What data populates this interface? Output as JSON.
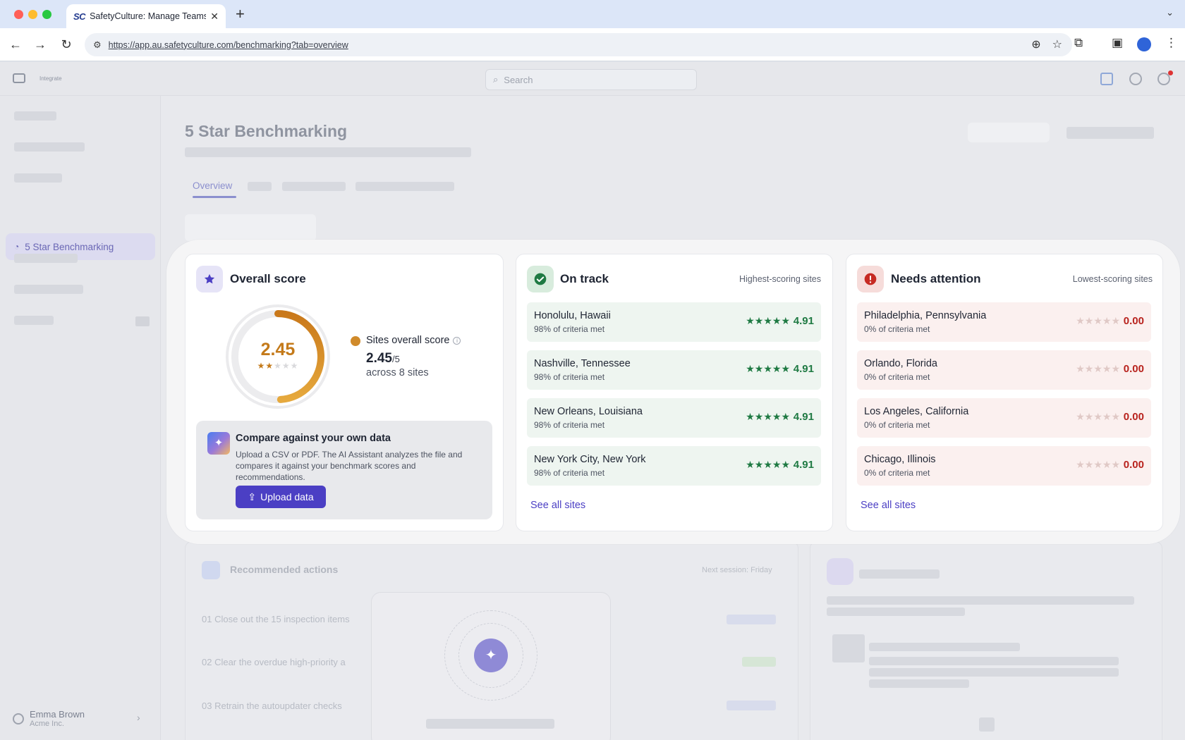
{
  "browser": {
    "tab_icon": "SC",
    "tab_title": "SafetyCulture: Manage Teams and...",
    "new_tab": "+",
    "url": "https://app.au.safetyculture.com/benchmarking?tab=overview"
  },
  "app": {
    "brand": "Integrate",
    "search_placeholder": "Search",
    "page_title": "5 Star Benchmarking",
    "active_tab": "Overview",
    "sidebar": {
      "active_item": "5 Star Benchmarking",
      "user_name": "Emma Brown",
      "user_org": "Acme Inc."
    },
    "recommended": {
      "title": "Recommended actions",
      "meta": "Next session: Friday",
      "items": [
        "01 Close out the 15 inspection items",
        "02 Clear the overdue high-priority a",
        "03 Retrain the autoupdater checks"
      ]
    }
  },
  "overall": {
    "title": "Overall score",
    "score": "2.45",
    "score_value": 2.45,
    "max_score": 5,
    "stars": "★★★★★",
    "legend_label": "Sites overall score",
    "big_score": "2.45",
    "big_score_max": "/5",
    "across": "across 8 sites",
    "compare_title": "Compare against your own data",
    "compare_desc": "Upload a CSV or PDF. The AI Assistant analyzes the file and compares it against your benchmark scores and recommendations.",
    "upload_label": "Upload data",
    "accent": "#d08a2a"
  },
  "on_track": {
    "title": "On track",
    "subtitle": "Highest-scoring sites",
    "accent": "#1f7a43",
    "sites": [
      {
        "name": "Honolulu, Hawaii",
        "meta": "98% of criteria met",
        "stars": "★★★★★",
        "score": "4.91"
      },
      {
        "name": "Nashville, Tennessee",
        "meta": "98% of criteria met",
        "stars": "★★★★★",
        "score": "4.91"
      },
      {
        "name": "New Orleans, Louisiana",
        "meta": "98% of criteria met",
        "stars": "★★★★★",
        "score": "4.91"
      },
      {
        "name": "New York City, New York",
        "meta": "98% of criteria met",
        "stars": "★★★★★",
        "score": "4.91"
      }
    ],
    "see_all": "See all sites"
  },
  "needs_attention": {
    "title": "Needs attention",
    "subtitle": "Lowest-scoring sites",
    "accent": "#b8231e",
    "sites": [
      {
        "name": "Philadelphia, Pennsylvania",
        "meta": "0% of criteria met",
        "stars": "★★★★★",
        "score": "0.00"
      },
      {
        "name": "Orlando, Florida",
        "meta": "0% of criteria met",
        "stars": "★★★★★",
        "score": "0.00"
      },
      {
        "name": "Los Angeles, California",
        "meta": "0% of criteria met",
        "stars": "★★★★★",
        "score": "0.00"
      },
      {
        "name": "Chicago, Illinois",
        "meta": "0% of criteria met",
        "stars": "★★★★★",
        "score": "0.00"
      }
    ],
    "see_all": "See all sites"
  },
  "icons": [
    "star-icon",
    "check-icon",
    "alert-icon",
    "upload-icon",
    "sparkle-icon",
    "search-icon",
    "info-icon"
  ]
}
